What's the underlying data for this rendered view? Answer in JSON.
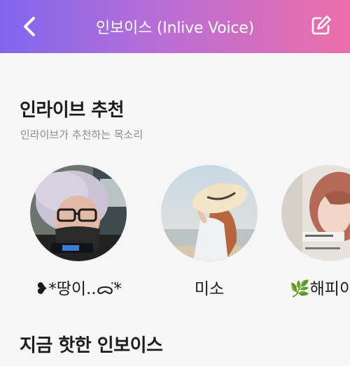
{
  "header": {
    "title": "인보이스 (Inlive Voice)",
    "gradient_start": "#7f66ee",
    "gradient_end": "#ec6fa9",
    "back_icon": "chevron-left-icon",
    "edit_icon": "edit-square-icon"
  },
  "recommend": {
    "title": "인라이브 추천",
    "subtitle": "인라이브가 추천하는 목소리",
    "items": [
      {
        "name": "❥*땅이..ᯅ̈*"
      },
      {
        "name": "미소"
      },
      {
        "name": "🌿해피이"
      }
    ]
  },
  "hot": {
    "title": "지금 핫한 인보이스"
  }
}
